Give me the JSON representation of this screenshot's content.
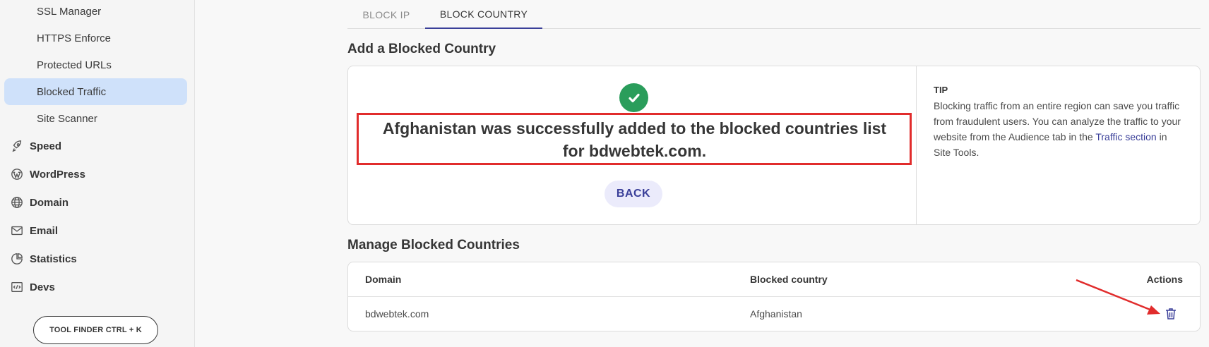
{
  "sidebar": {
    "sub_items": [
      {
        "label": "SSL Manager"
      },
      {
        "label": "HTTPS Enforce"
      },
      {
        "label": "Protected URLs"
      },
      {
        "label": "Blocked Traffic",
        "active": true
      },
      {
        "label": "Site Scanner"
      }
    ],
    "main_items": [
      {
        "label": "Speed",
        "icon": "rocket-icon"
      },
      {
        "label": "WordPress",
        "icon": "wordpress-icon"
      },
      {
        "label": "Domain",
        "icon": "globe-icon"
      },
      {
        "label": "Email",
        "icon": "envelope-icon"
      },
      {
        "label": "Statistics",
        "icon": "pie-chart-icon"
      },
      {
        "label": "Devs",
        "icon": "code-icon"
      }
    ],
    "tool_finder_label": "TOOL FINDER CTRL + K"
  },
  "tabs": [
    {
      "label": "BLOCK IP",
      "active": false
    },
    {
      "label": "BLOCK COUNTRY",
      "active": true
    }
  ],
  "add_section": {
    "title": "Add a Blocked Country",
    "success_message": "Afghanistan was successfully added to the blocked countries list for bdwebtek.com.",
    "back_label": "BACK",
    "tip": {
      "title": "TIP",
      "text_before": "Blocking traffic from an entire region can save you traffic from fraudulent users. You can analyze the traffic to your website from the Audience tab in the ",
      "link_text": "Traffic section",
      "text_after": " in Site Tools."
    }
  },
  "manage_section": {
    "title": "Manage Blocked Countries",
    "columns": [
      "Domain",
      "Blocked country",
      "Actions"
    ],
    "rows": [
      {
        "domain": "bdwebtek.com",
        "country": "Afghanistan"
      }
    ]
  },
  "colors": {
    "accent": "#3a3f99",
    "success": "#2a9d5b",
    "annotation_red": "#e12c2c",
    "active_sidebar": "#cfe1fa"
  }
}
